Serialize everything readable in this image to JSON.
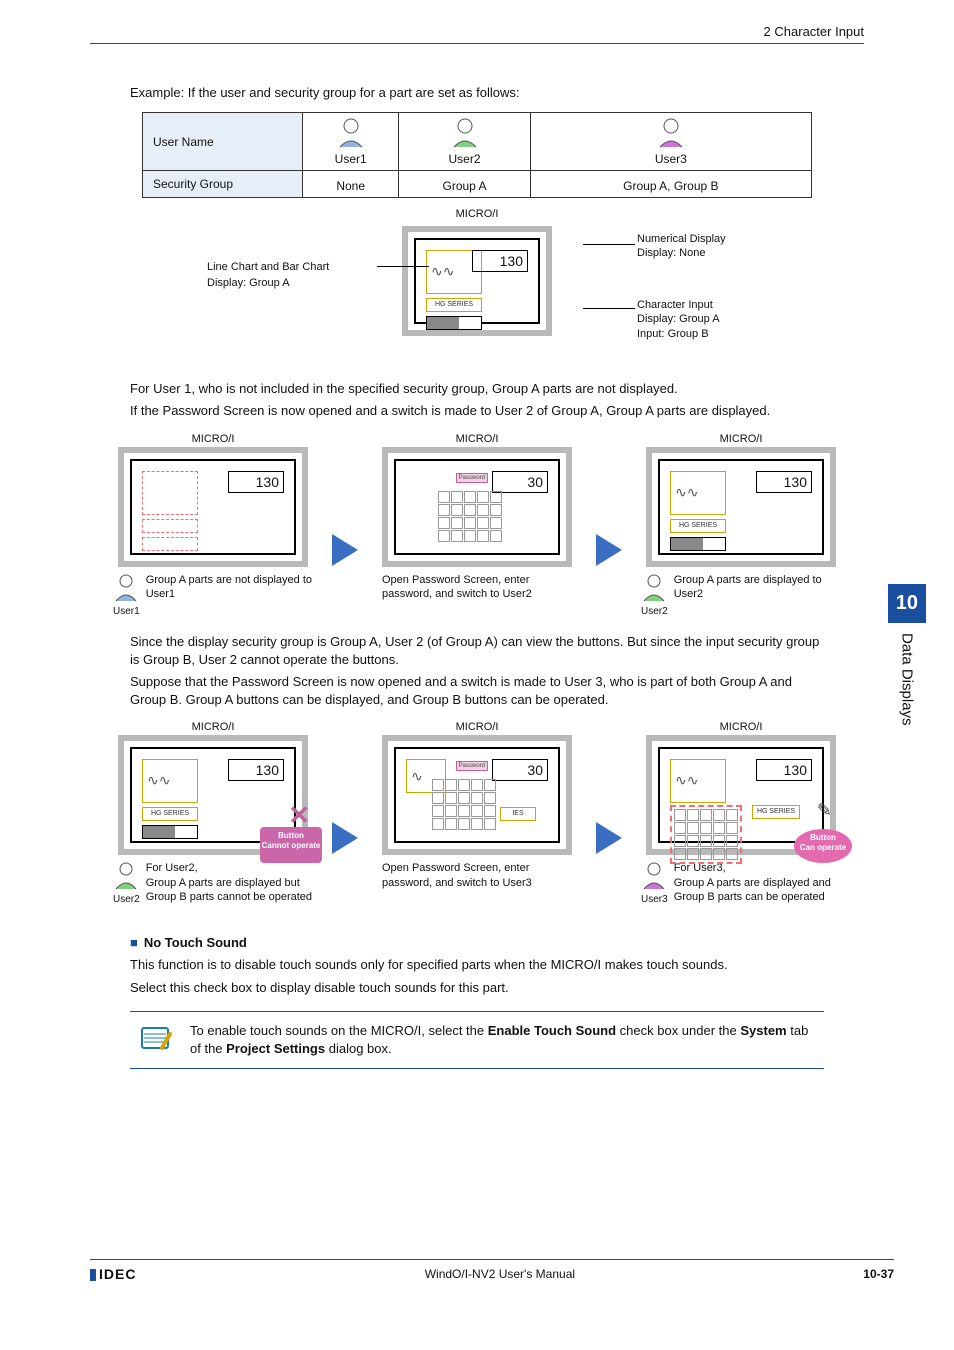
{
  "header": {
    "breadcrumb": "2 Character Input"
  },
  "intro": "Example: If the user and security group for a part are set as follows:",
  "user_table": {
    "row1_label": "User Name",
    "row2_label": "Security Group",
    "users": [
      {
        "name": "User1",
        "group": "None",
        "color": "#8fb4e0"
      },
      {
        "name": "User2",
        "group": "Group A",
        "color": "#7fd17f"
      },
      {
        "name": "User3",
        "group": "Group A, Group B",
        "color": "#c977d6"
      }
    ]
  },
  "diagram1": {
    "title": "MICRO/I",
    "num": "130",
    "hg": "HG SERIES",
    "left": "Line Chart and Bar Chart\nDisplay: Group A",
    "right_top": "Numerical Display\nDisplay: None",
    "right_bot": "Character Input\nDisplay: Group A\nInput: Group B"
  },
  "para2a": "For User 1, who is not included in the specified security group, Group A parts are not displayed.",
  "para2b": "If the Password Screen is now opened and a switch is made to User 2 of Group A, Group A parts are displayed.",
  "row2": {
    "micro": "MICRO/I",
    "num": "130",
    "num_masked": "30",
    "hg": "HG SERIES",
    "panels": {
      "p1": {
        "user": "User1",
        "caption": "Group A parts are not displayed to User1"
      },
      "p2": {
        "caption": "Open Password Screen, enter password, and switch to User2",
        "pw": "Password"
      },
      "p3": {
        "user": "User2",
        "caption": "Group A parts are displayed to User2"
      }
    }
  },
  "para3a": "Since the display security group is Group A, User 2 (of Group A) can view the buttons. But since the input security group is Group B, User 2 cannot operate the buttons.",
  "para3b": "Suppose that the Password Screen is now opened and a switch is made to User 3, who is part of both Group A and Group B. Group A buttons can be displayed, and Group B buttons can be operated.",
  "row3": {
    "micro": "MICRO/I",
    "num": "130",
    "num_masked": "30",
    "hg": "HG SERIES",
    "cannot": "Button\nCannot operate",
    "can": "Button\nCan operate",
    "panels": {
      "p1": {
        "user": "User2",
        "caption": "For User2,\nGroup A parts are displayed but Group B parts cannot be operated"
      },
      "p2": {
        "caption": "Open Password Screen, enter password, and switch to User3",
        "pw": "Password"
      },
      "p3": {
        "user": "User3",
        "caption": "For User3,\nGroup A parts are displayed and Group B parts can be operated"
      }
    }
  },
  "no_touch": {
    "heading": "No Touch Sound",
    "p1": "This function is to disable touch sounds only for specified parts when the MICRO/I makes touch sounds.",
    "p2": "Select this check box to display disable touch sounds for this part."
  },
  "notice": {
    "pre": "To enable touch sounds on the MICRO/I, select the ",
    "b1": "Enable Touch Sound",
    "mid": " check box under the ",
    "b2": "System",
    "post1": " tab of the ",
    "b3": "Project Settings",
    "post2": " dialog box."
  },
  "side": {
    "num": "10",
    "label": "Data Displays"
  },
  "footer": {
    "logo": "IDEC",
    "title": "WindO/I-NV2 User's Manual",
    "page": "10-37"
  }
}
